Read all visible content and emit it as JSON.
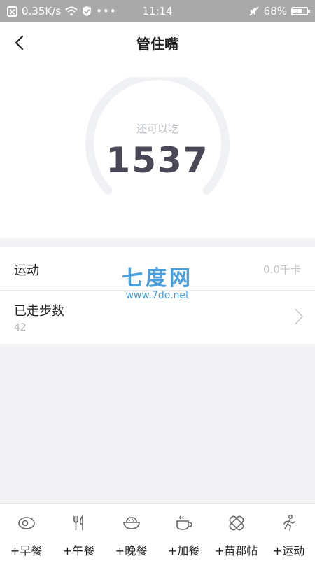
{
  "status_bar": {
    "network_speed": "0.35K/s",
    "time": "11:14",
    "battery_percent": "68%",
    "battery_level": 0.68
  },
  "header": {
    "title": "管住嘴"
  },
  "gauge": {
    "label": "还可以吃",
    "value": "1537"
  },
  "list": {
    "exercise": {
      "label": "运动",
      "value": "0.0千卡"
    },
    "steps": {
      "label": "已走步数",
      "count": "42"
    }
  },
  "watermark": {
    "main": "七度网",
    "sub": "www.7do.net"
  },
  "bottom_bar": {
    "tabs": [
      {
        "label": "+早餐",
        "icon": "egg-icon"
      },
      {
        "label": "+午餐",
        "icon": "fork-knife-icon"
      },
      {
        "label": "+晚餐",
        "icon": "rice-bowl-icon"
      },
      {
        "label": "+加餐",
        "icon": "coffee-cup-icon"
      },
      {
        "label": "+苗郡帖",
        "icon": "patch-icon"
      },
      {
        "label": "+运动",
        "icon": "running-icon"
      }
    ]
  },
  "colors": {
    "gauge_track": "#f0f1f4",
    "watermark": "#2a8fd9",
    "value_text": "#4a4857"
  }
}
